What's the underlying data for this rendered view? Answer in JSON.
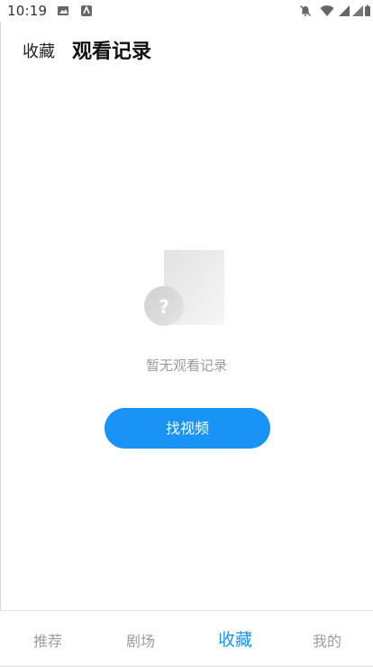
{
  "status_bar": {
    "time": "10:19",
    "icons": [
      "image-icon",
      "app-notice-icon",
      "do-not-disturb-icon",
      "wifi-icon",
      "signal-icon",
      "signal-alt-icon",
      "battery-icon"
    ]
  },
  "header": {
    "tabs": [
      {
        "label": "收藏",
        "active": false
      },
      {
        "label": "观看记录",
        "active": true
      }
    ]
  },
  "empty_state": {
    "icon": "question-document-icon",
    "message": "暂无观看记录",
    "button_label": "找视频"
  },
  "bottom_nav": {
    "items": [
      {
        "label": "推荐",
        "active": false
      },
      {
        "label": "剧场",
        "active": false
      },
      {
        "label": "收藏",
        "active": true
      },
      {
        "label": "我的",
        "active": false
      }
    ]
  },
  "colors": {
    "accent": "#1993f6",
    "muted_text": "#9a9a9a",
    "inactive_nav": "#9d9d9d"
  }
}
